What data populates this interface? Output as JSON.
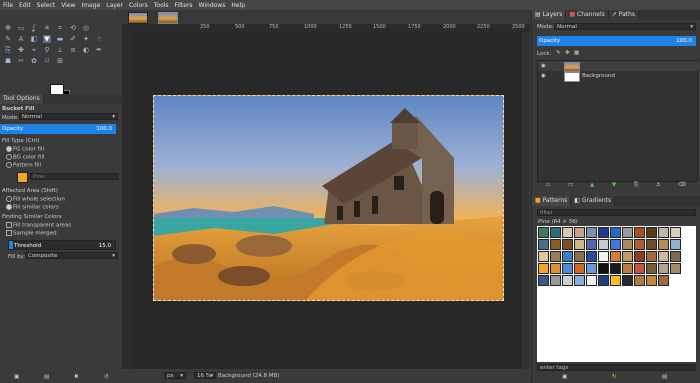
{
  "menubar": [
    "File",
    "Edit",
    "Select",
    "View",
    "Image",
    "Layer",
    "Colors",
    "Tools",
    "Filters",
    "Windows",
    "Help"
  ],
  "tool_options": {
    "tab": "Tool Options",
    "title": "Bucket Fill",
    "mode_label": "Mode:",
    "mode_value": "Normal",
    "opacity_label": "Opacity",
    "opacity_value": "100.0",
    "fill_type_label": "Fill Type  (Ctrl)",
    "fill_types": [
      "FG color fill",
      "BG color fill",
      "Pattern fill"
    ],
    "pattern_name": "Pine",
    "affected_label": "Affected Area  (Shift)",
    "affected_opts": [
      "Fill whole selection",
      "Fill similar colors"
    ],
    "finding_label": "Finding Similar Colors",
    "fill_transparent": "Fill transparent areas",
    "sample_merged": "Sample merged",
    "threshold_label": "Threshold",
    "threshold_value": "15.0",
    "fill_by_label": "Fill by:",
    "fill_by_value": "Composite"
  },
  "ruler_ticks": [
    "250",
    "500",
    "750",
    "1000",
    "1250",
    "1500",
    "1750",
    "2000",
    "2250",
    "2500"
  ],
  "status": {
    "unit": "px",
    "zoom": "16 %",
    "info": "Background (24.8 MB)"
  },
  "layers_panel": {
    "tabs": [
      "Layers",
      "Channels",
      "Paths"
    ],
    "mode_label": "Mode:",
    "mode_value": "Normal",
    "opacity_label": "Opacity",
    "opacity_value": "100.0",
    "lock_label": "Lock:",
    "layers": [
      "",
      "Background"
    ]
  },
  "patterns_panel": {
    "tabs": [
      "Patterns",
      "Gradients"
    ],
    "filter_placeholder": "filter",
    "selected_info": "Pine (64 × 56)",
    "tag_placeholder": "enter tags"
  },
  "colors": {
    "accent": "#1f82e6",
    "fg": "#ffffff",
    "bg": "#000000",
    "fill_swatch": "#f5a623"
  }
}
